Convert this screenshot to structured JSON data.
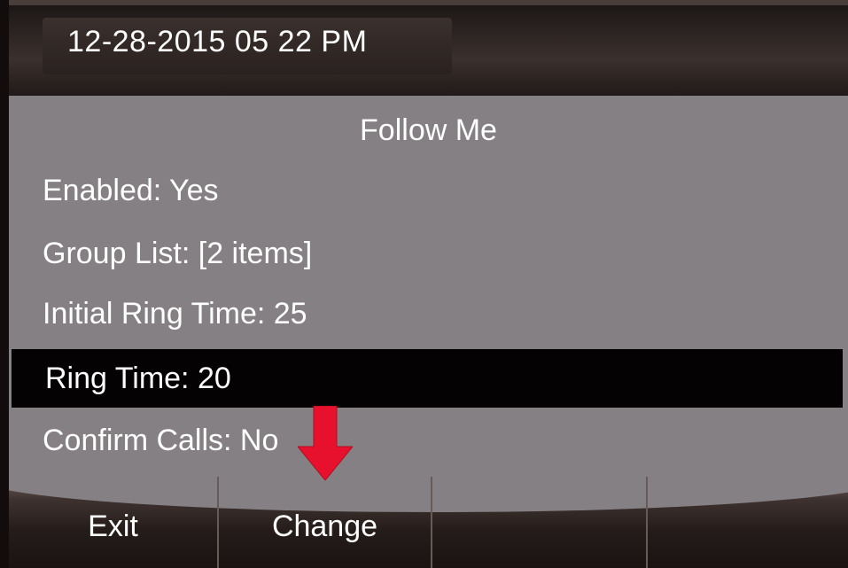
{
  "status_bar": {
    "datetime": "12-28-2015 05 22 PM"
  },
  "screen": {
    "title": "Follow Me",
    "items": [
      {
        "label": "Enabled: Yes",
        "selected": false
      },
      {
        "label": "Group List: [2 items]",
        "selected": false
      },
      {
        "label": "Initial Ring Time: 25",
        "selected": false
      },
      {
        "label": "Ring Time: 20",
        "selected": true
      },
      {
        "label": "Confirm Calls: No",
        "selected": false
      }
    ]
  },
  "softkeys": [
    {
      "label": "Exit"
    },
    {
      "label": "Change"
    },
    {
      "label": ""
    },
    {
      "label": ""
    }
  ],
  "colors": {
    "panel": "#858083",
    "selection": "#050203",
    "arrow": "#e8112d",
    "text": "#ffffff"
  },
  "icons": {
    "annotation": "down-arrow-icon"
  }
}
